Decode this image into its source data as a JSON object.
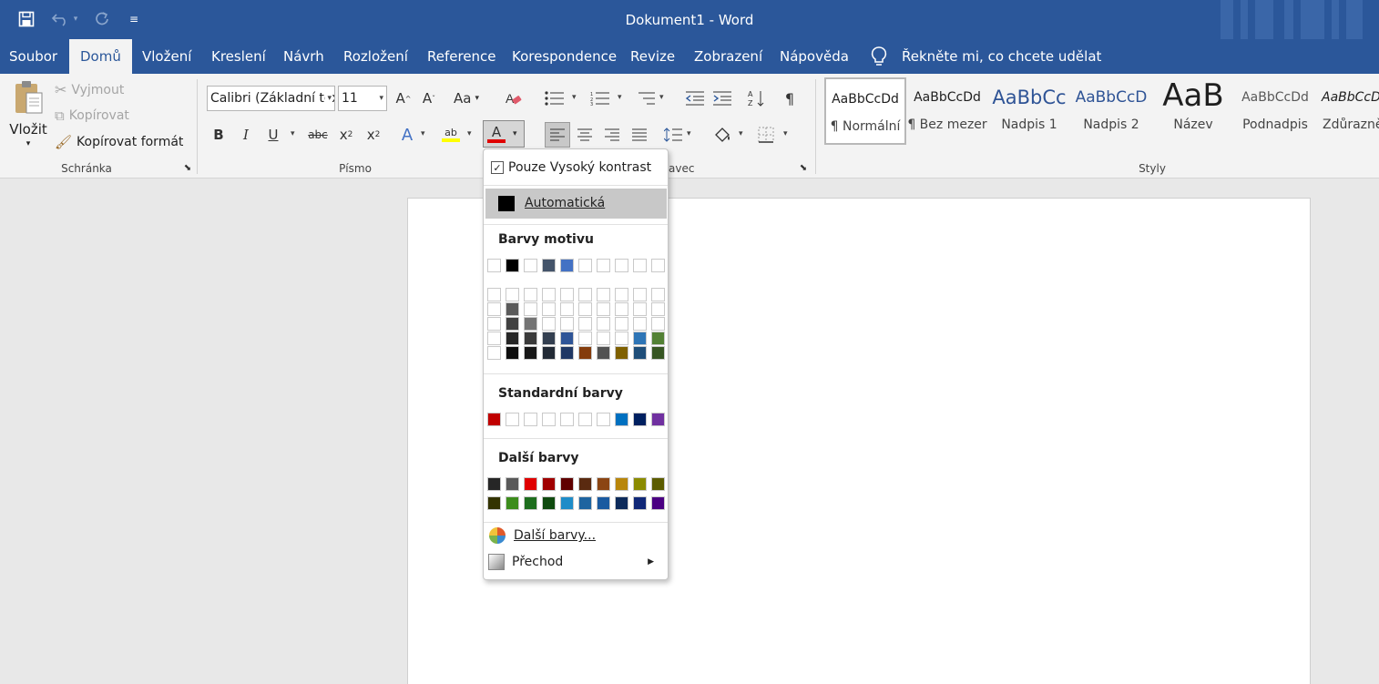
{
  "app": {
    "doc_title": "Dokument1",
    "separator": " - ",
    "app_name": "Word"
  },
  "quick_access": {
    "customize_glyph": "≡"
  },
  "tabs": [
    {
      "label": "Soubor"
    },
    {
      "label": "Domů",
      "active": true
    },
    {
      "label": "Vložení"
    },
    {
      "label": "Kreslení"
    },
    {
      "label": "Návrh"
    },
    {
      "label": "Rozložení"
    },
    {
      "label": "Reference"
    },
    {
      "label": "Korespondence"
    },
    {
      "label": "Revize"
    },
    {
      "label": "Zobrazení"
    },
    {
      "label": "Nápověda"
    }
  ],
  "tell_me": {
    "label": "Řekněte mi, co chcete udělat"
  },
  "clipboard": {
    "paste_label": "Vložit",
    "cut_label": "Vyjmout",
    "copy_label": "Kopírovat",
    "format_painter_label": "Kopírovat formát",
    "group_label": "Schránka"
  },
  "font": {
    "font_name": "Calibri (Základní text)",
    "font_size": "11",
    "group_label": "Písmo",
    "change_case_label": "Aa",
    "bold_label": "B",
    "italic_label": "I",
    "underline_label": "U",
    "strike_label": "abc",
    "highlight_label": "ab",
    "font_color_label": "A",
    "effects_label": "A",
    "font_color": "#e00000",
    "highlight_color": "#ffff00"
  },
  "paragraph": {
    "group_label_visible": "avec"
  },
  "styles": {
    "group_label": "Styly",
    "items": [
      {
        "preview": "AaBbCcDd",
        "name": "¶ Normální"
      },
      {
        "preview": "AaBbCcDd",
        "name": "¶ Bez mezer"
      },
      {
        "preview": "AaBbCc",
        "name": "Nadpis 1"
      },
      {
        "preview": "AaBbCcD",
        "name": "Nadpis 2"
      },
      {
        "preview": "AaB",
        "name": "Název"
      },
      {
        "preview": "AaBbCcDd",
        "name": "Podnadpis"
      },
      {
        "preview": "AaBbCcD",
        "name": "Zdůrazně"
      }
    ]
  },
  "color_menu": {
    "high_contrast_label": "Pouze Vysoký kontrast",
    "high_contrast_checked": true,
    "automatic_label": "Automatická",
    "theme_heading": "Barvy motivu",
    "standard_heading": "Standardní barvy",
    "recent_heading": "Další barvy",
    "more_colors_label": "Další barvy...",
    "gradient_label": "Přechod",
    "theme_top": [
      "#ffffff",
      "#000000",
      "#ffffff",
      "#44546a",
      "#4472c4",
      "#ffffff",
      "#ffffff",
      "#ffffff",
      "#ffffff",
      "#ffffff"
    ],
    "theme_shades": [
      [
        "#ffffff",
        "#ffffff",
        "#ffffff",
        "#ffffff",
        "#ffffff"
      ],
      [
        "#ffffff",
        "#5a5a5a",
        "#404040",
        "#262626",
        "#0d0d0d"
      ],
      [
        "#ffffff",
        "#ffffff",
        "#747474",
        "#3a3a3a",
        "#171717"
      ],
      [
        "#ffffff",
        "#ffffff",
        "#ffffff",
        "#333f50",
        "#222a35"
      ],
      [
        "#ffffff",
        "#ffffff",
        "#ffffff",
        "#2f5597",
        "#203864"
      ],
      [
        "#ffffff",
        "#ffffff",
        "#ffffff",
        "#ffffff",
        "#843c0c"
      ],
      [
        "#ffffff",
        "#ffffff",
        "#ffffff",
        "#ffffff",
        "#525252"
      ],
      [
        "#ffffff",
        "#ffffff",
        "#ffffff",
        "#ffffff",
        "#7f6000"
      ],
      [
        "#ffffff",
        "#ffffff",
        "#ffffff",
        "#2e75b6",
        "#1f4e79"
      ],
      [
        "#ffffff",
        "#ffffff",
        "#ffffff",
        "#538135",
        "#375623"
      ]
    ],
    "standard": [
      "#c00000",
      "#ffffff",
      "#ffffff",
      "#ffffff",
      "#ffffff",
      "#ffffff",
      "#ffffff",
      "#0070c0",
      "#002060",
      "#7030a0"
    ],
    "recent_row1": [
      "#262626",
      "#595959",
      "#e00000",
      "#a00000",
      "#600000",
      "#5a2a10",
      "#8b4513",
      "#b8860b",
      "#8b8b00",
      "#5c5c00"
    ],
    "recent_row2": [
      "#333300",
      "#3c8c1c",
      "#1e6e1e",
      "#0f4a0f",
      "#1e8cc8",
      "#1e64a0",
      "#1a5aa0",
      "#0c2a5a",
      "#102878",
      "#4b0082"
    ]
  }
}
